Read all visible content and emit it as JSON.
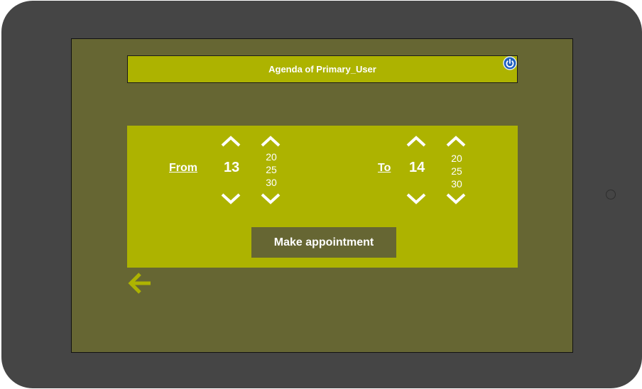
{
  "header": {
    "title": "Agenda of Primary_User"
  },
  "from": {
    "label": "From",
    "hour": "13",
    "minutes": [
      "20",
      "25",
      "30"
    ]
  },
  "to": {
    "label": "To",
    "hour": "14",
    "minutes": [
      "20",
      "25",
      "30"
    ]
  },
  "actions": {
    "make_appointment": "Make appointment"
  },
  "icons": {
    "power": "power-icon",
    "chevron_up": "chevron-up-icon",
    "chevron_down": "chevron-down-icon",
    "back": "arrow-left-icon"
  },
  "colors": {
    "device": "#454545",
    "screen": "#666633",
    "accent": "#adb300",
    "text": "#ffffff",
    "power": "#1f5fbf"
  }
}
